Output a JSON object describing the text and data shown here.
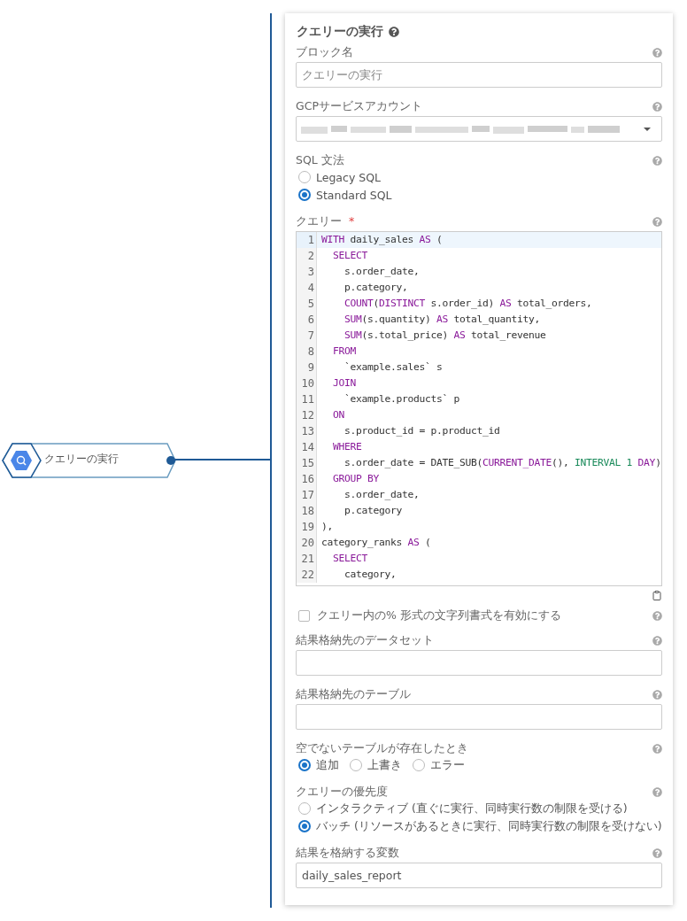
{
  "node": {
    "label": "クエリーの実行"
  },
  "panel": {
    "title": "クエリーの実行"
  },
  "fields": [
    {
      "kind": "text",
      "label": "ブロック名",
      "placeholder": "クエリーの実行"
    },
    {
      "kind": "select",
      "label": "GCPサービスアカウント"
    },
    {
      "kind": "radio",
      "label": "SQL 文法",
      "options": [
        {
          "label": "Legacy SQL",
          "selected": false
        },
        {
          "label": "Standard SQL",
          "selected": true
        }
      ]
    },
    {
      "kind": "code",
      "label": "クエリー",
      "required_mark": "*",
      "lines": [
        {
          "number": "1",
          "active": true,
          "tokens": [
            {
              "kind": "keyword",
              "text": "WITH"
            },
            {
              "kind": "plain",
              "text": " daily_sales "
            },
            {
              "kind": "keyword",
              "text": "AS"
            },
            {
              "kind": "plain",
              "text": " ("
            }
          ]
        },
        {
          "number": "2",
          "active": false,
          "tokens": [
            {
              "kind": "keyword",
              "text": "  SELECT"
            }
          ]
        },
        {
          "number": "3",
          "active": false,
          "tokens": [
            {
              "kind": "plain",
              "text": "    s.order_date,"
            }
          ]
        },
        {
          "number": "4",
          "active": false,
          "tokens": [
            {
              "kind": "plain",
              "text": "    p.category,"
            }
          ]
        },
        {
          "number": "5",
          "active": false,
          "tokens": [
            {
              "kind": "keyword",
              "text": "    COUNT"
            },
            {
              "kind": "plain",
              "text": "("
            },
            {
              "kind": "keyword",
              "text": "DISTINCT"
            },
            {
              "kind": "plain",
              "text": " s.order_id) "
            },
            {
              "kind": "keyword",
              "text": "AS"
            },
            {
              "kind": "plain",
              "text": " total_orders,"
            }
          ]
        },
        {
          "number": "6",
          "active": false,
          "tokens": [
            {
              "kind": "keyword",
              "text": "    SUM"
            },
            {
              "kind": "plain",
              "text": "(s.quantity) "
            },
            {
              "kind": "keyword",
              "text": "AS"
            },
            {
              "kind": "plain",
              "text": " total_quantity,"
            }
          ]
        },
        {
          "number": "7",
          "active": false,
          "tokens": [
            {
              "kind": "keyword",
              "text": "    SUM"
            },
            {
              "kind": "plain",
              "text": "(s.total_price) "
            },
            {
              "kind": "keyword",
              "text": "AS"
            },
            {
              "kind": "plain",
              "text": " total_revenue"
            }
          ]
        },
        {
          "number": "8",
          "active": false,
          "tokens": [
            {
              "kind": "keyword",
              "text": "  FROM"
            }
          ]
        },
        {
          "number": "9",
          "active": false,
          "tokens": [
            {
              "kind": "plain",
              "text": "    `example.sales` s"
            }
          ]
        },
        {
          "number": "10",
          "active": false,
          "tokens": [
            {
              "kind": "keyword",
              "text": "  JOIN"
            }
          ]
        },
        {
          "number": "11",
          "active": false,
          "tokens": [
            {
              "kind": "plain",
              "text": "    `example.products` p"
            }
          ]
        },
        {
          "number": "12",
          "active": false,
          "tokens": [
            {
              "kind": "keyword",
              "text": "  ON"
            }
          ]
        },
        {
          "number": "13",
          "active": false,
          "tokens": [
            {
              "kind": "plain",
              "text": "    s.product_id = p.product_id"
            }
          ]
        },
        {
          "number": "14",
          "active": false,
          "tokens": [
            {
              "kind": "keyword",
              "text": "  WHERE"
            }
          ]
        },
        {
          "number": "15",
          "active": false,
          "tokens": [
            {
              "kind": "plain",
              "text": "    s.order_date = DATE_SUB("
            },
            {
              "kind": "keyword",
              "text": "CURRENT_DATE"
            },
            {
              "kind": "plain",
              "text": "(), "
            },
            {
              "kind": "literal",
              "text": "INTERVAL 1 "
            },
            {
              "kind": "keyword",
              "text": "DAY"
            },
            {
              "kind": "plain",
              "text": ")"
            }
          ]
        },
        {
          "number": "16",
          "active": false,
          "tokens": [
            {
              "kind": "keyword",
              "text": "  GROUP BY"
            }
          ]
        },
        {
          "number": "17",
          "active": false,
          "tokens": [
            {
              "kind": "plain",
              "text": "    s.order_date,"
            }
          ]
        },
        {
          "number": "18",
          "active": false,
          "tokens": [
            {
              "kind": "plain",
              "text": "    p.category"
            }
          ]
        },
        {
          "number": "19",
          "active": false,
          "tokens": [
            {
              "kind": "plain",
              "text": "),"
            }
          ]
        },
        {
          "number": "20",
          "active": false,
          "tokens": [
            {
              "kind": "plain",
              "text": "category_ranks "
            },
            {
              "kind": "keyword",
              "text": "AS"
            },
            {
              "kind": "plain",
              "text": " ("
            }
          ]
        },
        {
          "number": "21",
          "active": false,
          "tokens": [
            {
              "kind": "keyword",
              "text": "  SELECT"
            }
          ]
        },
        {
          "number": "22",
          "active": false,
          "tokens": [
            {
              "kind": "plain",
              "text": "    category,"
            }
          ]
        }
      ]
    },
    {
      "kind": "checkbox",
      "label": "クエリー内の% 形式の文字列書式を有効にする",
      "checked": false
    },
    {
      "kind": "text",
      "label": "結果格納先のデータセット"
    },
    {
      "kind": "text",
      "label": "結果格納先のテーブル"
    },
    {
      "kind": "radiorow",
      "label": "空でないテーブルが存在したとき",
      "options": [
        {
          "label": "追加",
          "selected": true
        },
        {
          "label": "上書き",
          "selected": false
        },
        {
          "label": "エラー",
          "selected": false
        }
      ]
    },
    {
      "kind": "radio",
      "label": "クエリーの優先度",
      "options": [
        {
          "label": "インタラクティブ (直ぐに実行、同時実行数の制限を受ける)",
          "selected": false
        },
        {
          "label": "バッチ (リソースがあるときに実行、同時実行数の制限を受けない)",
          "selected": true
        }
      ]
    },
    {
      "kind": "text",
      "label": "結果を格納する変数",
      "value": "daily_sales_report"
    }
  ]
}
